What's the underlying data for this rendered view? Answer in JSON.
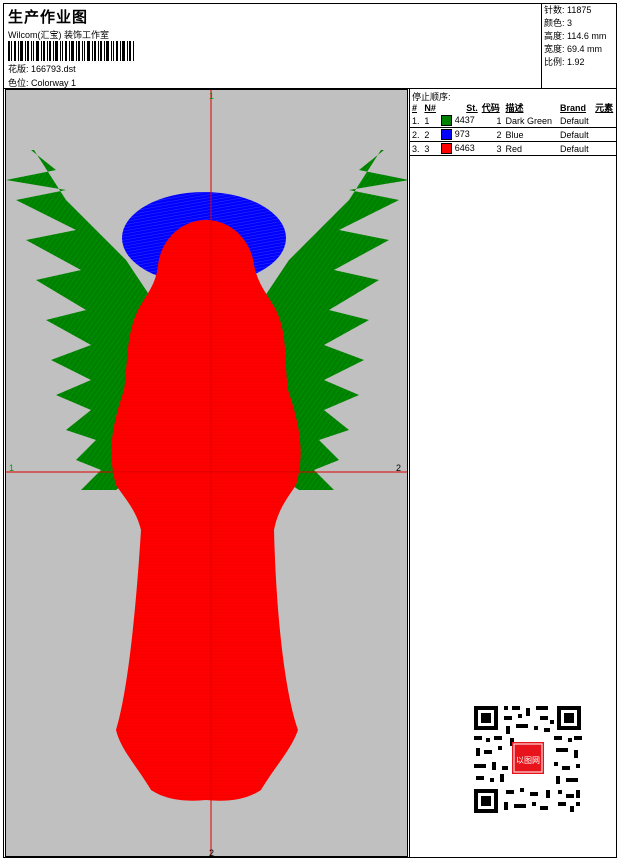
{
  "header": {
    "title": "生产作业图",
    "company": "Wilcom(汇宝) 装饰工作室",
    "design_label": "花版:",
    "design_value": "166793.dst",
    "colorway_label": "色位:",
    "colorway_value": "Colorway 1"
  },
  "stats": {
    "stitches": "针数: 11875",
    "colors": "颜色: 3",
    "height": "高度: 114.6 mm",
    "width": "宽度: 69.4 mm",
    "scale": "比例: 1.92"
  },
  "stop_sequence": {
    "title": "停止顺序:",
    "headers": [
      "#",
      "N#",
      "St.",
      "代码",
      "描述",
      "Brand",
      "元素"
    ],
    "rows": [
      {
        "num": "1.",
        "needle": "1",
        "color": "#008000",
        "stitches": "4437",
        "code": "1",
        "desc": "Dark Green",
        "brand": "Default"
      },
      {
        "num": "2.",
        "needle": "2",
        "color": "#0000ff",
        "stitches": "973",
        "code": "2",
        "desc": "Blue",
        "brand": "Default"
      },
      {
        "num": "3.",
        "needle": "3",
        "color": "#ff0000",
        "stitches": "6463",
        "code": "3",
        "desc": "Red",
        "brand": "Default"
      }
    ]
  },
  "canvas": {
    "marker_top": "1",
    "marker_left": "1",
    "marker_right": "2",
    "marker_bottom": "2",
    "colors": {
      "wings": "#008000",
      "halo": "#0000ff",
      "body": "#ff0000",
      "background": "#c0c0c0",
      "crosshair": "#e00000"
    }
  },
  "watermark": {
    "stamp_text": "以图网"
  }
}
